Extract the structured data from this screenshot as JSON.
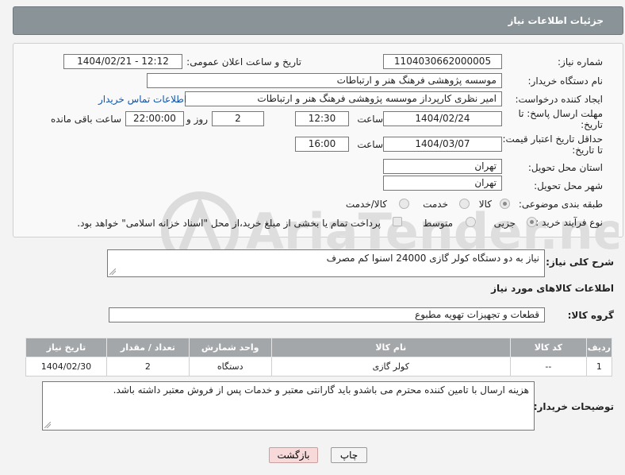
{
  "header": {
    "title": "جزئیات اطلاعات نیاز"
  },
  "form": {
    "need_number_label": "شماره نیاز:",
    "need_number_value": "1104030662000005",
    "announce_label": "تاریخ و ساعت اعلان عمومی:",
    "announce_value": "1404/02/21 - 12:12",
    "buyer_org_label": "نام دستگاه خریدار:",
    "buyer_org_value": "موسسه پژوهشی فرهنگ  هنر و ارتباطات",
    "requester_label": "ایجاد کننده درخواست:",
    "requester_value": "امیر نظری کارپرداز موسسه پژوهشی فرهنگ  هنر و ارتباطات",
    "contact_link": "اطلاعات تماس خریدار",
    "deadline_label_1": "مهلت ارسال پاسخ: تا",
    "deadline_label_2": "تاریخ:",
    "deadline_date": "1404/02/24",
    "time_label": "ساعت",
    "deadline_time": "12:30",
    "days_value": "2",
    "days_label": "روز و",
    "remaining_value": "22:00:00",
    "remaining_label": "ساعت باقی مانده",
    "validity_label_1": "حداقل تاریخ اعتبار قیمت:",
    "validity_label_2": "تا تاریخ:",
    "validity_date": "1404/03/07",
    "validity_time": "16:00",
    "province_label": "استان محل تحویل:",
    "province_value": "تهران",
    "city_label": "شهر محل تحویل:",
    "city_value": "تهران",
    "category_label": "طبقه بندی موضوعی:",
    "category_options": [
      "کالا",
      "خدمت",
      "کالا/خدمت"
    ],
    "category_selected": "کالا",
    "process_label": "نوع فرآیند خرید :",
    "process_options": [
      "جزیی",
      "متوسط"
    ],
    "process_selected": "جزیی",
    "payment_note": "پرداخت تمام یا بخشی از مبلغ خرید،از محل \"اسناد خزانه اسلامی\" خواهد بود."
  },
  "summary": {
    "label": "شرح کلی نیاز:",
    "value": "نیاز به دو دستگاه کولر گازی 24000 اسنوا کم مصرف"
  },
  "goods_section_title": "اطلاعات کالاهای مورد نیاز",
  "goods_group": {
    "label": "گروه کالا:",
    "value": "قطعات و تجهیزات تهویه مطبوع"
  },
  "table": {
    "headers": [
      "ردیف",
      "کد کالا",
      "نام کالا",
      "واحد شمارش",
      "تعداد / مقدار",
      "تاریخ نیاز"
    ],
    "rows": [
      [
        "1",
        "--",
        "کولر گازی",
        "دستگاه",
        "2",
        "1404/02/30"
      ]
    ]
  },
  "buyer_notes": {
    "label": "توضیحات خریدار:",
    "value": "هزینه ارسال با تامین کننده محترم می باشدو باید گارانتی معتبر و خدمات پس از فروش معتبر داشته باشد."
  },
  "buttons": {
    "print": "چاپ",
    "back": "بازگشت"
  },
  "watermark": {
    "text": "AriaTender.neT"
  },
  "colors": {
    "header_bg": "#8a9398",
    "table_header_bg": "#a3a7aa",
    "link": "#1155aa",
    "back_button_bg": "#f7d9d9",
    "watermark": "#d9d9d9"
  }
}
